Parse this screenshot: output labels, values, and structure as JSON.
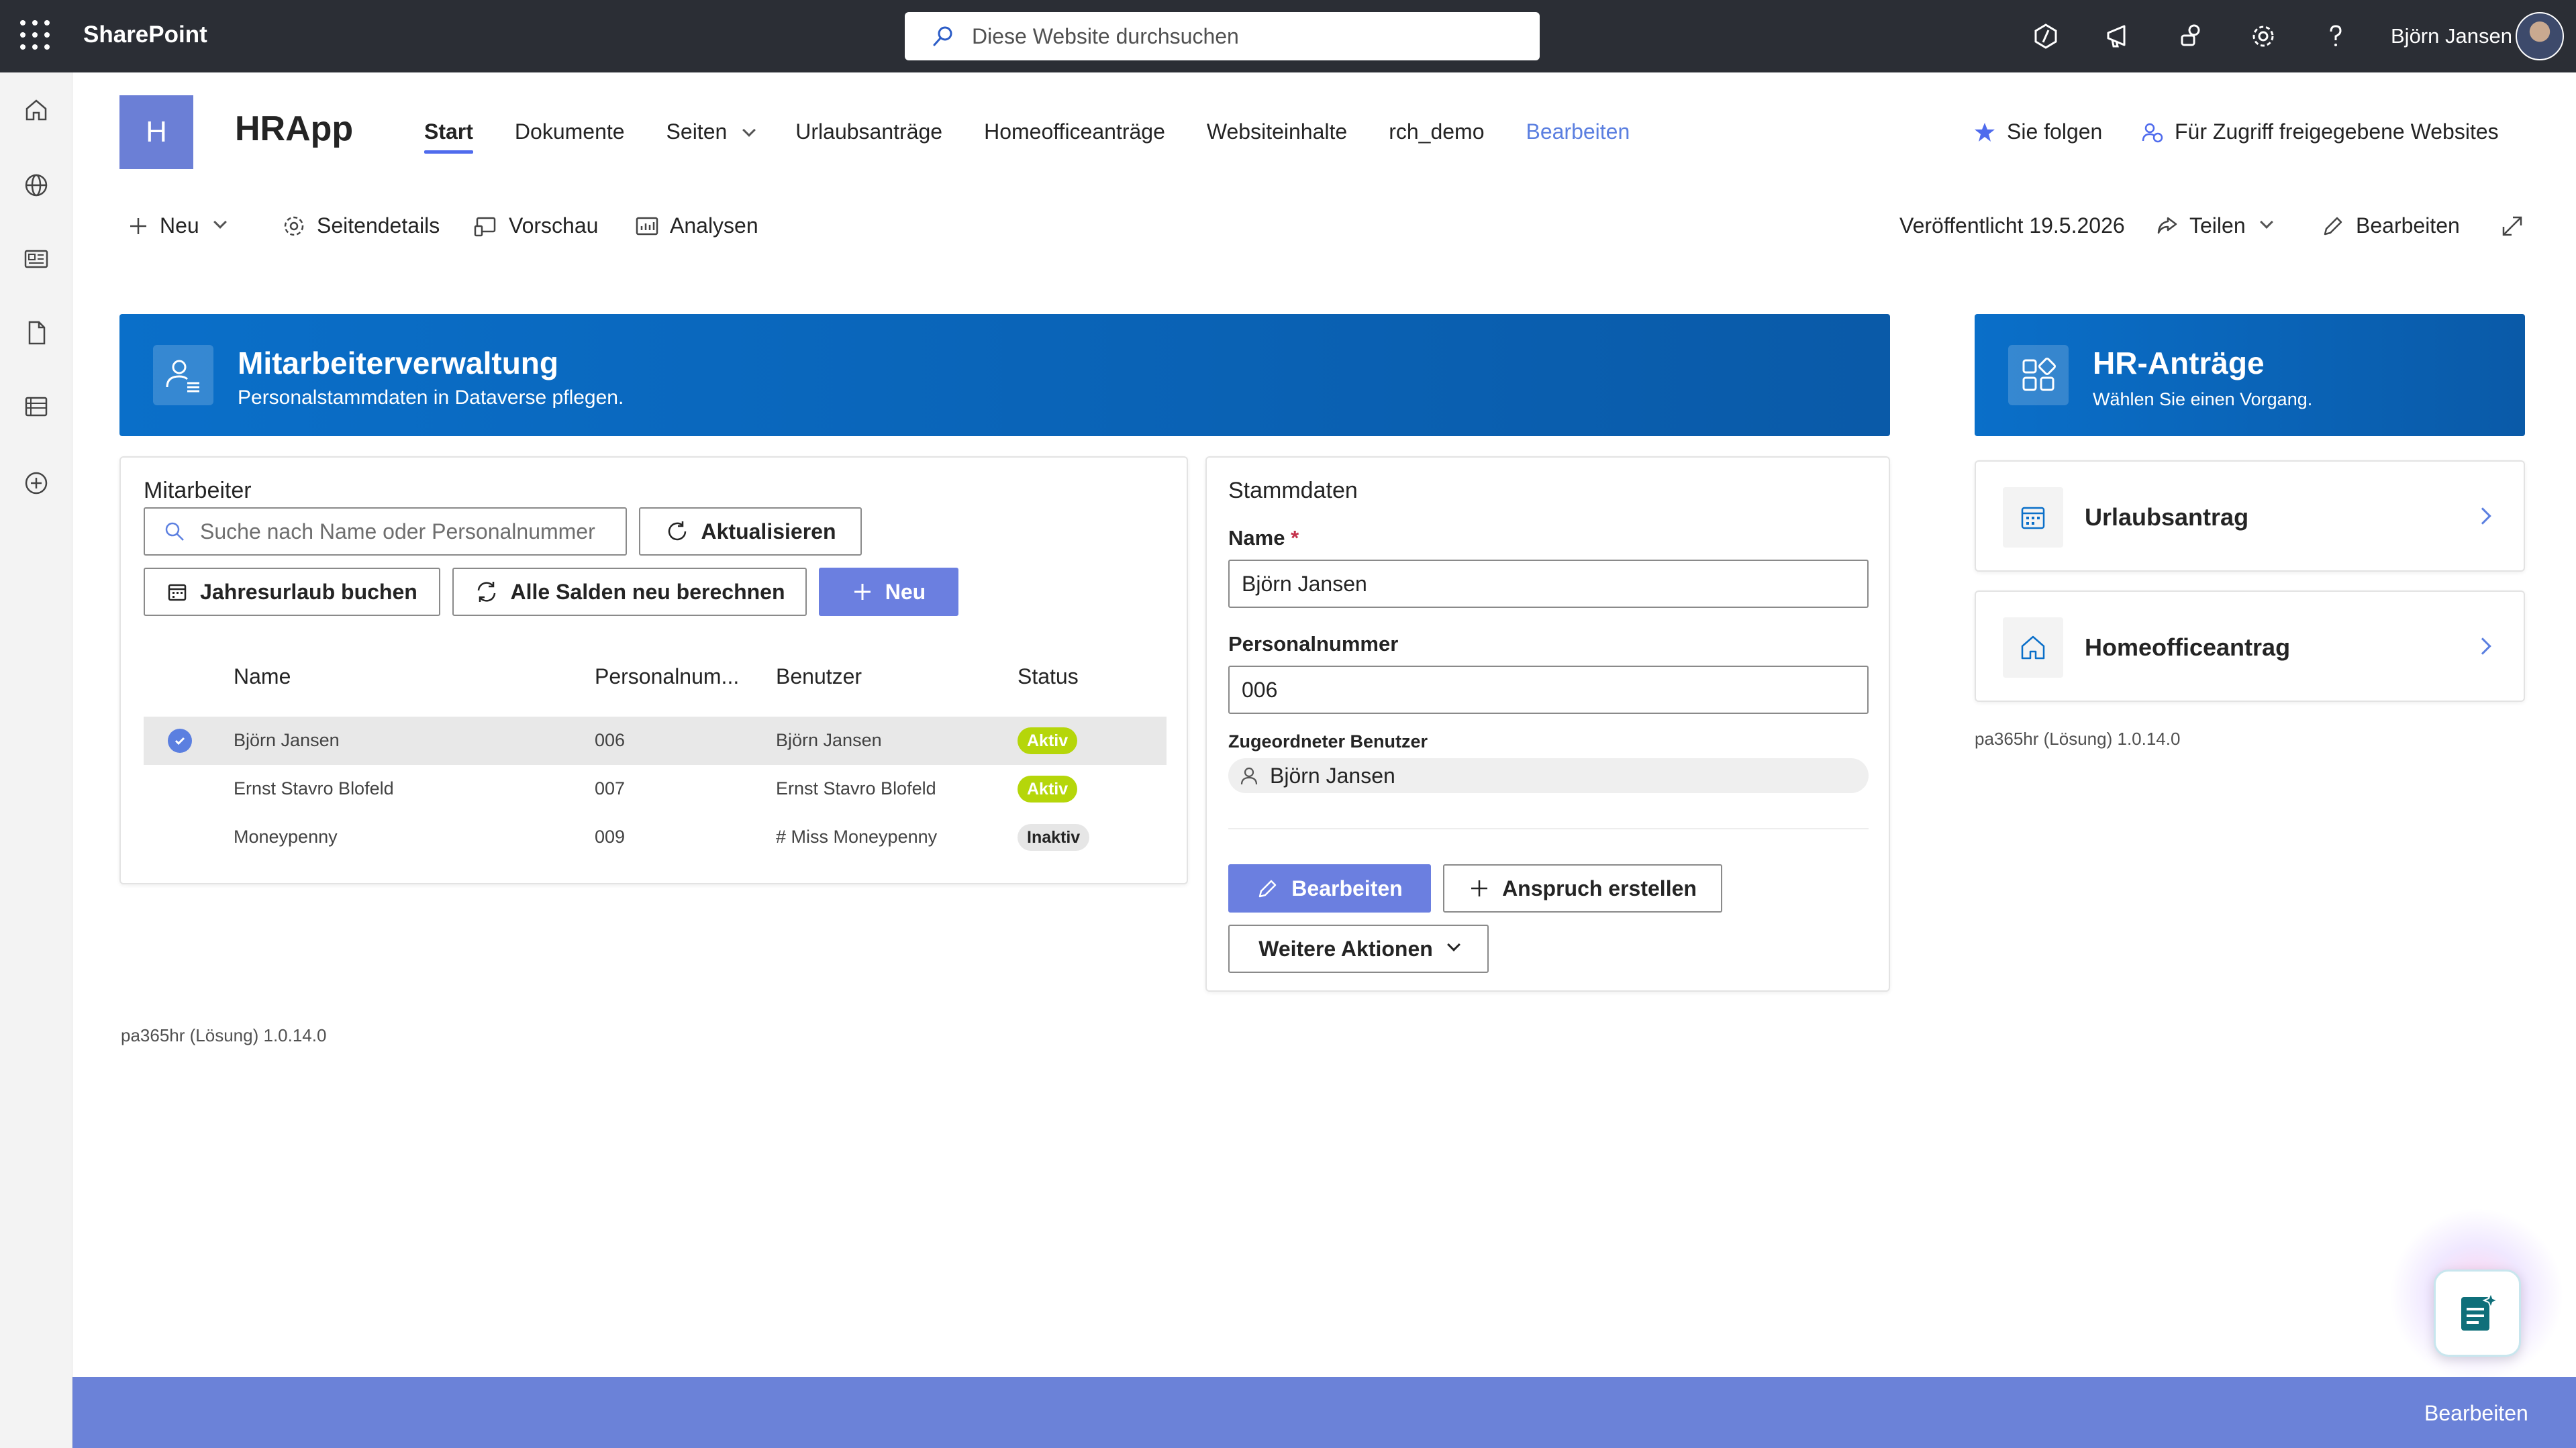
{
  "topbar": {
    "brand": "SharePoint",
    "search_placeholder": "Diese Website durchsuchen",
    "user_name": "Björn Jansen"
  },
  "site": {
    "logo_letter": "H",
    "title": "HRApp",
    "nav": [
      {
        "label": "Start"
      },
      {
        "label": "Dokumente"
      },
      {
        "label": "Seiten"
      },
      {
        "label": "Urlaubsanträge"
      },
      {
        "label": "Homeofficeanträge"
      },
      {
        "label": "Websiteinhalte"
      },
      {
        "label": "rch_demo"
      },
      {
        "label": "Bearbeiten"
      }
    ],
    "follow_label": "Sie folgen",
    "shared_label": "Für Zugriff freigegebene Websites"
  },
  "commandbar": {
    "new_label": "Neu",
    "page_details_label": "Seitendetails",
    "preview_label": "Vorschau",
    "analytics_label": "Analysen",
    "published_label": "Veröffentlicht 19.5.2026",
    "share_label": "Teilen",
    "edit_label": "Bearbeiten"
  },
  "employee_banner": {
    "title": "Mitarbeiterverwaltung",
    "subtitle": "Personalstammdaten in Dataverse pflegen."
  },
  "hr_banner": {
    "title": "HR-Anträge",
    "subtitle": "Wählen Sie einen Vorgang."
  },
  "employees": {
    "heading": "Mitarbeiter",
    "search_placeholder": "Suche nach Name oder Personalnummer",
    "refresh_label": "Aktualisieren",
    "annual_leave_label": "Jahresurlaub buchen",
    "recalc_label": "Alle Salden neu berechnen",
    "new_label": "Neu",
    "columns": [
      "Name",
      "Personalnum...",
      "Benutzer",
      "Status"
    ],
    "rows": [
      {
        "name": "Björn Jansen",
        "number": "006",
        "user": "Björn Jansen",
        "status": "Aktiv"
      },
      {
        "name": "Ernst Stavro Blofeld",
        "number": "007",
        "user": "Ernst Stavro Blofeld",
        "status": "Aktiv"
      },
      {
        "name": "Moneypenny",
        "number": "009",
        "user": "# Miss Moneypenny",
        "status": "Inaktiv"
      }
    ]
  },
  "master_data": {
    "heading": "Stammdaten",
    "name_label": "Name",
    "required_mark": "*",
    "name_value": "Björn Jansen",
    "number_label": "Personalnummer",
    "number_value": "006",
    "user_label": "Zugeordneter Benutzer",
    "user_value": "Björn Jansen",
    "edit_label": "Bearbeiten",
    "create_claim_label": "Anspruch erstellen",
    "more_actions_label": "Weitere Aktionen"
  },
  "requests": {
    "vacation_label": "Urlaubsantrag",
    "homeoffice_label": "Homeofficeantrag",
    "version": "pa365hr (Lösung) 1.0.14.0"
  },
  "left_version": "pa365hr (Lösung) 1.0.14.0",
  "footer": {
    "edit_label": "Bearbeiten"
  },
  "colors": {
    "accent": "#4f6bed",
    "banner": "#0a6fc9",
    "primary_button": "#6b7fe0",
    "status_active": "#b5d60a",
    "footer": "#6b82d8"
  }
}
